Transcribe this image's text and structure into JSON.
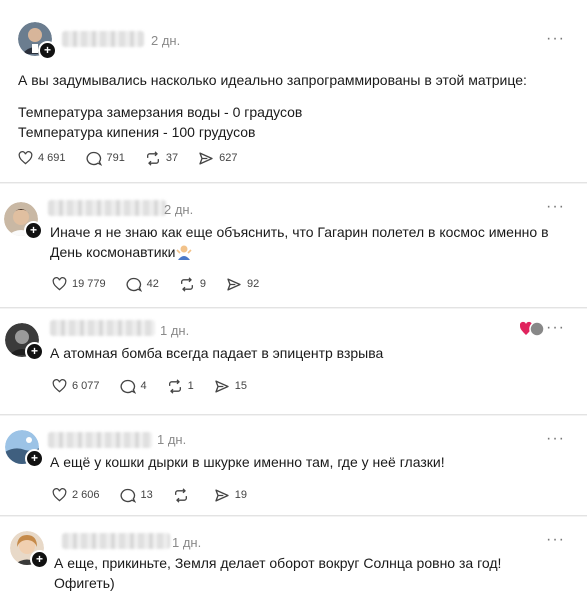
{
  "posts": [
    {
      "time": "2 дн.",
      "more": "···",
      "text_lines": [
        "А вы задумывались насколько идеально запрограммированы в этой матрице:",
        "",
        "Температура замерзания воды - 0 градусов",
        "Температура кипения - 100 грудусов"
      ],
      "likes": "4 691",
      "comments": "791",
      "reposts": "37",
      "shares": "627"
    },
    {
      "time": "2 дн.",
      "more": "···",
      "text_lines": [
        "Иначе я не знаю как еще объяснить, что Гагарин полетел в космос именно в",
        "День космонавтики"
      ],
      "likes": "19 779",
      "comments": "42",
      "reposts": "9",
      "shares": "92"
    },
    {
      "time": "1 дн.",
      "more": "···",
      "text_lines": [
        "А атомная бомба всегда падает в эпицентр взрыва"
      ],
      "likes": "6 077",
      "comments": "4",
      "reposts": "1",
      "shares": "15"
    },
    {
      "time": "1 дн.",
      "more": "···",
      "text_lines": [
        "А ещё у кошки дырки в шкурке именно там, где у неё глазки!"
      ],
      "likes": "2 606",
      "comments": "13",
      "reposts": "",
      "shares": "19"
    },
    {
      "time": "1 дн.",
      "more": "···",
      "text_lines": [
        "А еще, прикиньте, Земля делает оборот вокруг Солнца ровно за год!",
        "Офигеть)"
      ]
    }
  ],
  "icons": {
    "like": "heart-icon",
    "comment": "comment-bubble-icon",
    "repost": "repost-arrows-icon",
    "share": "share-send-icon",
    "follow": "plus-badge-icon"
  },
  "colors": {
    "background": "#f3f3f3",
    "card": "#ffffff",
    "text": "#1a1a1a",
    "muted": "#8a8a8a",
    "reaction_heart": "#e0245e"
  }
}
